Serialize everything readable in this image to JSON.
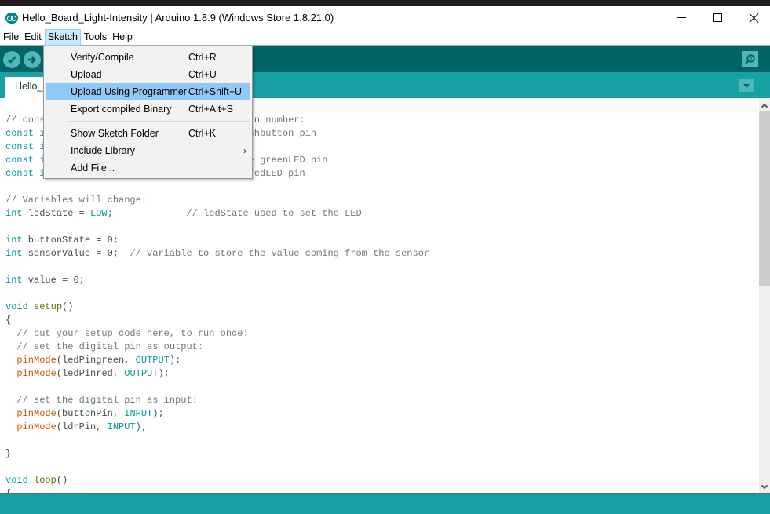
{
  "window": {
    "title": "Hello_Board_Light-Intensity | Arduino 1.8.9 (Windows Store 1.8.21.0)",
    "controls": {
      "minimize": "minimize-icon",
      "maximize": "maximize-icon",
      "close": "close-icon"
    }
  },
  "menubar": {
    "items": [
      {
        "label": "File"
      },
      {
        "label": "Edit"
      },
      {
        "label": "Sketch",
        "active": true
      },
      {
        "label": "Tools"
      },
      {
        "label": "Help"
      }
    ]
  },
  "toolbar": {
    "buttons": [
      {
        "name": "verify",
        "icon": "checkmark-icon"
      },
      {
        "name": "upload",
        "icon": "arrow-right-icon"
      }
    ],
    "serial_monitor_icon": "magnifier-icon"
  },
  "tabs": [
    {
      "label": "Hello_"
    }
  ],
  "sketch_menu": {
    "items": [
      {
        "label": "Verify/Compile",
        "shortcut": "Ctrl+R"
      },
      {
        "label": "Upload",
        "shortcut": "Ctrl+U"
      },
      {
        "label": "Upload Using Programmer",
        "shortcut": "Ctrl+Shift+U",
        "highlighted": true
      },
      {
        "label": "Export compiled Binary",
        "shortcut": "Ctrl+Alt+S"
      },
      {
        "label": "Show Sketch Folder",
        "shortcut": "Ctrl+K"
      },
      {
        "label": "Include Library",
        "shortcut": "",
        "submenu": true
      },
      {
        "label": "Add File...",
        "shortcut": ""
      }
    ]
  },
  "editor": {
    "lines": [
      [
        {
          "t": "// cons",
          "c": "c"
        },
        {
          "t": "                                   pin number:",
          "c": "c"
        }
      ],
      [
        {
          "t": "const i",
          "c": "k"
        },
        {
          "t": "                                   ushbutton pin",
          "c": "c"
        }
      ],
      [
        {
          "t": "const i",
          "c": "k"
        }
      ],
      [
        {
          "t": "const i",
          "c": "k"
        },
        {
          "t": "                                   he greenLED pin",
          "c": "c"
        }
      ],
      [
        {
          "t": "const i",
          "c": "k"
        },
        {
          "t": "                                    redLED pin",
          "c": "c"
        }
      ],
      [],
      [
        {
          "t": "// Variables will change:",
          "c": "c"
        }
      ],
      [
        {
          "t": "int",
          "c": "k"
        },
        {
          "t": " ledState = ",
          "c": ""
        },
        {
          "t": "LOW",
          "c": "cn"
        },
        {
          "t": ";             ",
          "c": ""
        },
        {
          "t": "// ledState used to set the LED",
          "c": "c"
        }
      ],
      [],
      [
        {
          "t": "int",
          "c": "k"
        },
        {
          "t": " buttonState = 0;",
          "c": ""
        }
      ],
      [
        {
          "t": "int",
          "c": "k"
        },
        {
          "t": " sensorValue = 0;  ",
          "c": ""
        },
        {
          "t": "// variable to store the value coming from the sensor",
          "c": "c"
        }
      ],
      [],
      [
        {
          "t": "int",
          "c": "k"
        },
        {
          "t": " value = 0;",
          "c": ""
        }
      ],
      [],
      [
        {
          "t": "void",
          "c": "k"
        },
        {
          "t": " ",
          "c": ""
        },
        {
          "t": "setup",
          "c": "fn2"
        },
        {
          "t": "()",
          "c": ""
        }
      ],
      [
        {
          "t": "{",
          "c": ""
        }
      ],
      [
        {
          "t": "  // put your setup code here, to run once:",
          "c": "c"
        }
      ],
      [
        {
          "t": "  // set the digital pin as output:",
          "c": "c"
        }
      ],
      [
        {
          "t": "  ",
          "c": ""
        },
        {
          "t": "pinMode",
          "c": "f"
        },
        {
          "t": "(ledPingreen, ",
          "c": ""
        },
        {
          "t": "OUTPUT",
          "c": "cn"
        },
        {
          "t": ");",
          "c": ""
        }
      ],
      [
        {
          "t": "  ",
          "c": ""
        },
        {
          "t": "pinMode",
          "c": "f"
        },
        {
          "t": "(ledPinred, ",
          "c": ""
        },
        {
          "t": "OUTPUT",
          "c": "cn"
        },
        {
          "t": ");",
          "c": ""
        }
      ],
      [],
      [
        {
          "t": "  // set the digital pin as input:",
          "c": "c"
        }
      ],
      [
        {
          "t": "  ",
          "c": ""
        },
        {
          "t": "pinMode",
          "c": "f"
        },
        {
          "t": "(buttonPin, ",
          "c": ""
        },
        {
          "t": "INPUT",
          "c": "cn"
        },
        {
          "t": ");",
          "c": ""
        }
      ],
      [
        {
          "t": "  ",
          "c": ""
        },
        {
          "t": "pinMode",
          "c": "f"
        },
        {
          "t": "(ldrPin, ",
          "c": ""
        },
        {
          "t": "INPUT",
          "c": "cn"
        },
        {
          "t": ");",
          "c": ""
        }
      ],
      [],
      [
        {
          "t": "}",
          "c": ""
        }
      ],
      [],
      [
        {
          "t": "void",
          "c": "k"
        },
        {
          "t": " ",
          "c": ""
        },
        {
          "t": "loop",
          "c": "fn2"
        },
        {
          "t": "()",
          "c": ""
        }
      ],
      [
        {
          "t": "{",
          "c": ""
        }
      ]
    ]
  }
}
